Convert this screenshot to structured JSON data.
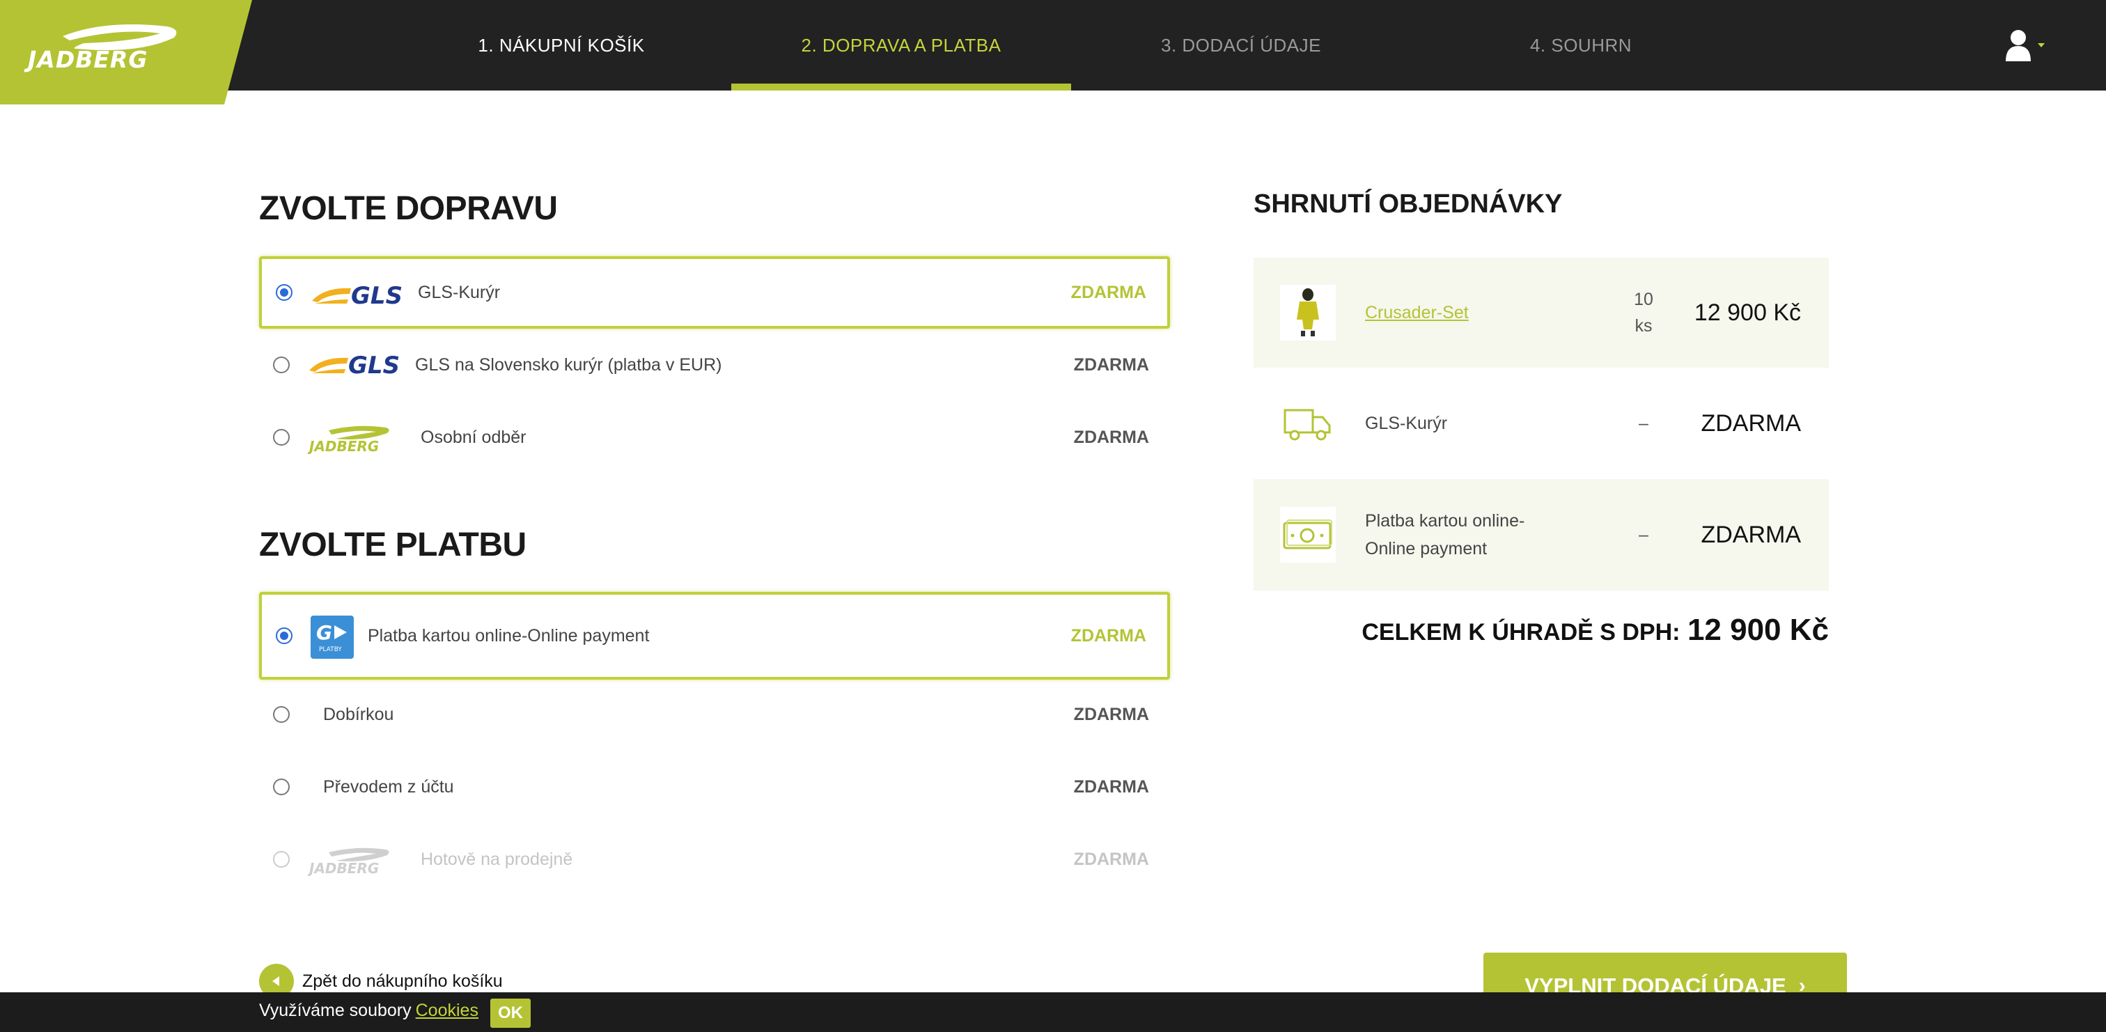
{
  "header": {
    "logo_text": "JADBERG",
    "steps": [
      {
        "label": "1. NÁKUPNÍ KOŠÍK"
      },
      {
        "label": "2. DOPRAVA A PLATBA"
      },
      {
        "label": "3. DODACÍ ÚDAJE"
      },
      {
        "label": "4. SOUHRN"
      }
    ],
    "active_step": 2,
    "user_icon": "user-icon"
  },
  "shipping": {
    "title": "ZVOLTE DOPRAVU",
    "options": [
      {
        "label": "GLS-Kurýr",
        "price": "ZDARMA",
        "logo": "gls-logo",
        "selected": true
      },
      {
        "label": "GLS na Slovensko kurýr (platba v EUR)",
        "price": "ZDARMA",
        "logo": "gls-logo",
        "selected": false
      },
      {
        "label": "Osobní odběr",
        "price": "ZDARMA",
        "logo": "jadberg-logo",
        "selected": false
      }
    ]
  },
  "payment": {
    "title": "ZVOLTE PLATBU",
    "options": [
      {
        "label": "Platba kartou online-Online payment",
        "price": "ZDARMA",
        "logo": "gopay-logo",
        "logo_text": "PLATBY",
        "selected": true
      },
      {
        "label": "Dobírkou",
        "price": "ZDARMA",
        "selected": false
      },
      {
        "label": "Převodem z účtu",
        "price": "ZDARMA",
        "selected": false
      },
      {
        "label": "Hotově na prodejně",
        "price": "ZDARMA",
        "logo": "jadberg-logo",
        "selected": false,
        "disabled": true
      }
    ]
  },
  "summary": {
    "title": "SHRNUTÍ OBJEDNÁVKY",
    "rows": [
      {
        "name": "Crusader-Set",
        "qty": "10",
        "unit": "ks",
        "price": "12 900 Kč",
        "icon": "product-thumbnail"
      },
      {
        "name": "GLS-Kurýr",
        "qty": "–",
        "price": "ZDARMA",
        "icon": "truck-icon"
      },
      {
        "name_line1": "Platba kartou online-",
        "name_line2": "Online payment",
        "qty": "–",
        "price": "ZDARMA",
        "icon": "cash-icon"
      }
    ],
    "total_label": "CELKEM K ÚHRADĚ S DPH:",
    "total_value": "12 900 Kč"
  },
  "footer": {
    "back_label": "Zpět do nákupního košíku",
    "next_label": "VYPLNIT DODACÍ ÚDAJE",
    "cookie_text": "Využíváme soubory",
    "cookie_link": "Cookies",
    "cookie_ok": "OK"
  },
  "colors": {
    "accent": "#b4c334",
    "header_bg": "#222222",
    "radio_selected": "#2d6ad8",
    "gls_yellow": "#f2b01e",
    "gls_blue": "#1f3a8c"
  }
}
